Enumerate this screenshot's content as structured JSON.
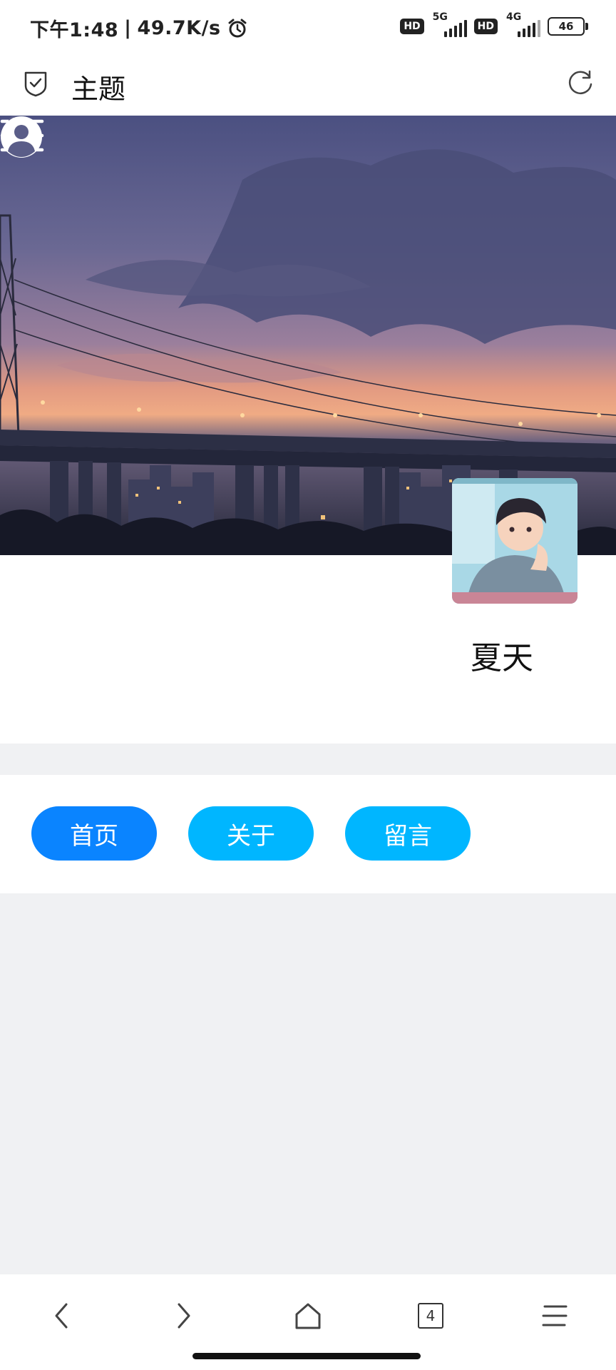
{
  "status_bar": {
    "time": "下午1:48",
    "separator": "|",
    "speed": "49.7K/s",
    "sim1_badge": "HD",
    "sim1_network": "5G",
    "sim2_badge": "HD",
    "sim2_network": "4G",
    "battery_level": "46"
  },
  "titlebar": {
    "title": "主题"
  },
  "profile": {
    "name": "夏天"
  },
  "nav": {
    "home_label": "首页",
    "about_label": "关于",
    "message_label": "留言"
  },
  "toolbar": {
    "tabs_count": "4"
  },
  "colors": {
    "active_pill": "#0a84ff",
    "pill": "#00b6ff",
    "page_bg": "#f0f1f3"
  }
}
